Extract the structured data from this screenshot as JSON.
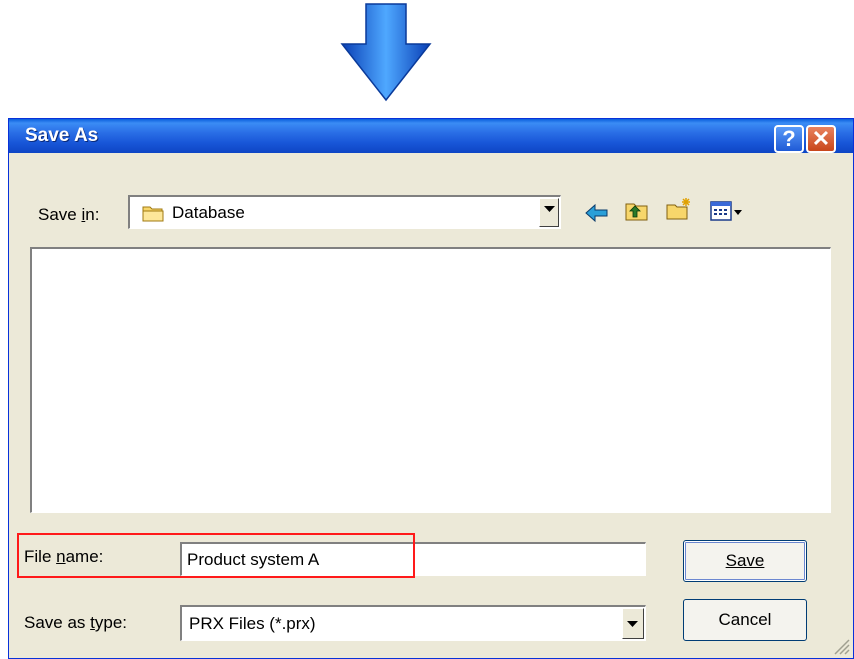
{
  "dialog": {
    "title": "Save As"
  },
  "save_in": {
    "label": "Save in:",
    "current_folder": "Database"
  },
  "toolbar": {
    "icons": [
      "back-arrow-icon",
      "up-folder-icon",
      "new-folder-icon",
      "view-menu-icon"
    ]
  },
  "file_name": {
    "label": "File name:",
    "value": "Product system A"
  },
  "save_as_type": {
    "label": "Save as type:",
    "value": "PRX Files (*.prx)"
  },
  "buttons": {
    "save": "Save",
    "cancel": "Cancel"
  },
  "colors": {
    "titlebar": "#0a5fdc",
    "highlight": "#ff1a1a",
    "arrow": "#1a6ee8"
  }
}
